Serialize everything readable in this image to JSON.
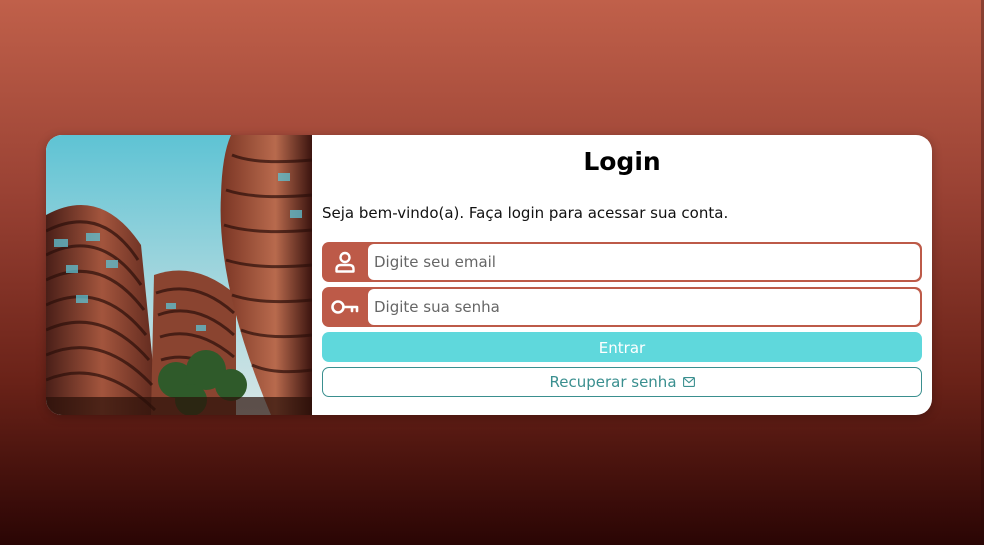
{
  "login": {
    "title": "Login",
    "subtitle": "Seja bem-vindo(a). Faça login para acessar sua conta.",
    "email_placeholder": "Digite seu email",
    "password_placeholder": "Digite sua senha",
    "submit_label": "Entrar",
    "recover_label": "Recuperar senha"
  },
  "icons": {
    "email_field": "user-icon",
    "password_field": "key-icon",
    "recover": "mail-icon"
  },
  "colors": {
    "accent": "#bd5a48",
    "primary_button": "#5fd8dc",
    "recover_text": "#3a8f8f"
  }
}
